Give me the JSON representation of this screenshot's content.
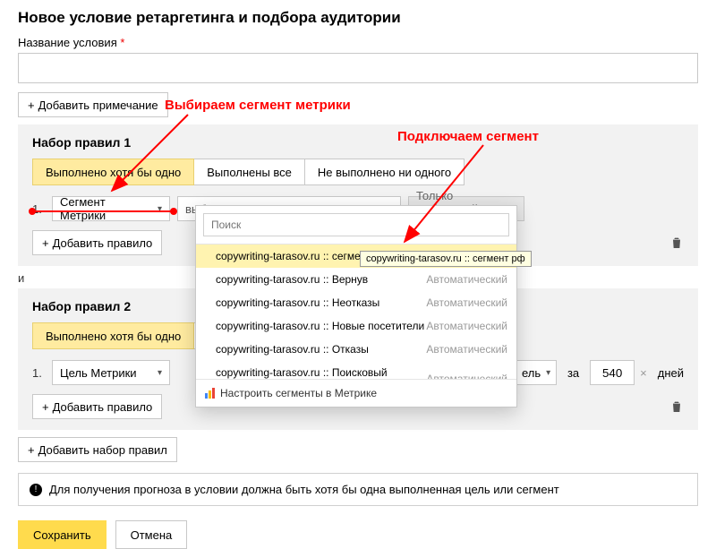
{
  "header": {
    "title": "Новое условие ретаргетинга и подбора аудитории",
    "name_label": "Название условия",
    "required_mark": "*"
  },
  "buttons": {
    "add_note": "Добавить примечание",
    "add_rule": "Добавить правило",
    "add_ruleset": "Добавить набор правил",
    "save": "Сохранить",
    "cancel": "Отмена",
    "plus": "+"
  },
  "tabs_labels": {
    "any": "Выполнено хотя бы одно",
    "all": "Выполнены все",
    "none": "Не выполнено ни одного"
  },
  "ruleset1": {
    "title": "Набор правил 1",
    "type_select": "Сегмент Метрики",
    "segment_placeholder": "выберите сегмент",
    "scope_select": "Только выбранный сег…"
  },
  "and_label": "и",
  "ruleset2": {
    "title": "Набор правил 2",
    "type_select": "Цель Метрики",
    "scope_select": "ель",
    "za": "за",
    "days_value": "540",
    "days_label": "дней"
  },
  "dropdown": {
    "search_placeholder": "Поиск",
    "items": [
      {
        "label": "copywriting-tarasov.ru :: сегмент рф",
        "auto": ""
      },
      {
        "label": "copywriting-tarasov.ru :: Вернув",
        "auto": "Автоматический"
      },
      {
        "label": "copywriting-tarasov.ru :: Неотказы",
        "auto": "Автоматический"
      },
      {
        "label": "copywriting-tarasov.ru :: Новые посетители",
        "auto": "Автоматический"
      },
      {
        "label": "copywriting-tarasov.ru :: Отказы",
        "auto": "Автоматический"
      },
      {
        "label": "copywriting-tarasov.ru :: Поисковый трафик",
        "auto": "Автоматический"
      }
    ],
    "footer": "Настроить сегменты в Метрике"
  },
  "tooltip_text": "copywriting-tarasov.ru :: сегмент рф",
  "alert_text": "Для получения прогноза в условии должна быть хотя бы одна выполненная цель или сегмент",
  "annotations": {
    "a1": "Выбираем сегмент метрики",
    "a2": "Подключаем сегмент"
  }
}
